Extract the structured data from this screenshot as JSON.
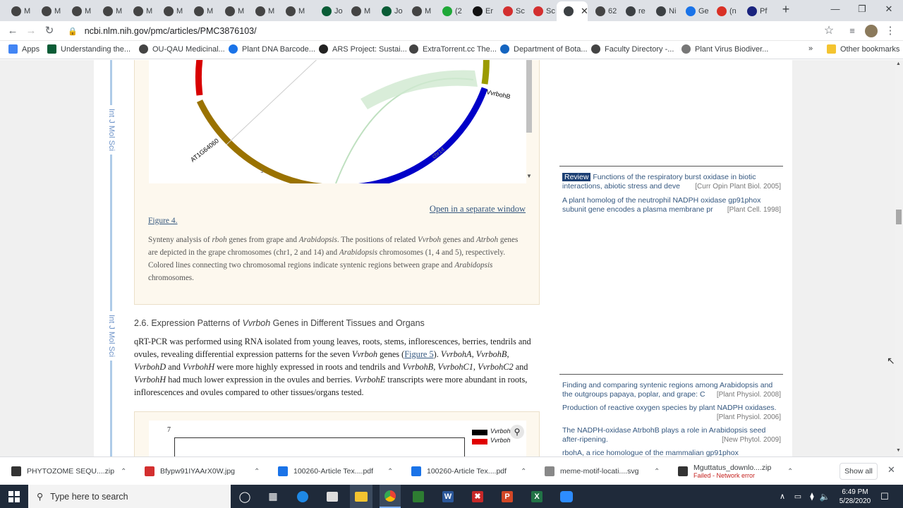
{
  "browser": {
    "tabs": [
      {
        "label": "M",
        "icon": "github-icon",
        "color": "#444"
      },
      {
        "label": "M",
        "icon": "github-icon",
        "color": "#444"
      },
      {
        "label": "M",
        "icon": "github-icon",
        "color": "#444"
      },
      {
        "label": "M",
        "icon": "github-icon",
        "color": "#444"
      },
      {
        "label": "M",
        "icon": "github-icon",
        "color": "#444"
      },
      {
        "label": "M",
        "icon": "github-icon",
        "color": "#444"
      },
      {
        "label": "M",
        "icon": "github-icon",
        "color": "#444"
      },
      {
        "label": "M",
        "icon": "github-icon",
        "color": "#444"
      },
      {
        "label": "M",
        "icon": "github-icon",
        "color": "#444"
      },
      {
        "label": "M",
        "icon": "github-icon",
        "color": "#444"
      },
      {
        "label": "Jo",
        "icon": "mendeley-icon",
        "color": "#0a5c36"
      },
      {
        "label": "M",
        "icon": "github-icon",
        "color": "#444"
      },
      {
        "label": "Jo",
        "icon": "mendeley-icon",
        "color": "#0a5c36"
      },
      {
        "label": "M",
        "icon": "github-icon",
        "color": "#444"
      },
      {
        "label": "(2",
        "icon": "green-circle-icon",
        "color": "#1fa838"
      },
      {
        "label": "Er",
        "icon": "d-icon",
        "color": "#111"
      },
      {
        "label": "Sc",
        "icon": "acrobat-icon",
        "color": "#d32f2f"
      },
      {
        "label": "Sc",
        "icon": "acrobat-icon",
        "color": "#d32f2f"
      },
      {
        "label": "",
        "icon": "ncbi-icon",
        "color": "#3c4043"
      },
      {
        "label": "62",
        "icon": "github-icon",
        "color": "#444"
      },
      {
        "label": "re",
        "icon": "ncbi-icon",
        "color": "#3c4043"
      },
      {
        "label": "Ni",
        "icon": "ncbi-icon",
        "color": "#3c4043"
      },
      {
        "label": "Ge",
        "icon": "diamond-icon",
        "color": "#1a73e8"
      },
      {
        "label": "(n",
        "icon": "gmail-icon",
        "color": "#d93025"
      },
      {
        "label": "Pf",
        "icon": "pfam-icon",
        "color": "#1a237e"
      }
    ],
    "url": "ncbi.nlm.nih.gov/pmc/articles/PMC3876103/",
    "bookmarks": [
      {
        "label": "Apps",
        "color": "#4285f4"
      },
      {
        "label": "Understanding the...",
        "color": "#0a5c36"
      },
      {
        "label": "OU-QAU Medicinal...",
        "color": "#444"
      },
      {
        "label": "Plant DNA Barcode...",
        "color": "#1a73e8"
      },
      {
        "label": "ARS Project: Sustai...",
        "color": "#222"
      },
      {
        "label": "ExtraTorrent.cc The...",
        "color": "#444"
      },
      {
        "label": "Department of Bota...",
        "color": "#1565c0"
      },
      {
        "label": "Faculty Directory -...",
        "color": "#444"
      },
      {
        "label": "Plant Virus Biodiver...",
        "color": "#777"
      }
    ],
    "bookmarks_more": "»",
    "other_bookmarks": "Other bookmarks"
  },
  "figure": {
    "labels": {
      "atig": "AT1G64060",
      "vvrbohb": "VvrbohB",
      "chr14": "chr14",
      "one": "1"
    },
    "open_window": "Open in a separate window",
    "figure_label": "Figure 4.",
    "caption": [
      {
        "t": "Synteny analysis of ",
        "i": false
      },
      {
        "t": "rboh",
        "i": true
      },
      {
        "t": " genes from grape and ",
        "i": false
      },
      {
        "t": "Arabidopsis",
        "i": true
      },
      {
        "t": ". The positions of related ",
        "i": false
      },
      {
        "t": "Vvrboh",
        "i": true
      },
      {
        "t": " genes and ",
        "i": false
      },
      {
        "t": "Atrboh",
        "i": true
      },
      {
        "t": " genes are depicted in the grape chromosomes (chr1, 2 and 14) and ",
        "i": false
      },
      {
        "t": "Arabidopsis",
        "i": true
      },
      {
        "t": " chromosomes (1, 4 and 5), respectively. Colored lines connecting two chromosomal regions indicate syntenic regions between grape and ",
        "i": false
      },
      {
        "t": "Arabidopsis",
        "i": true
      },
      {
        "t": " chromosomes.",
        "i": false
      }
    ]
  },
  "section": {
    "heading_parts": [
      {
        "t": "2.6. Expression Patterns of ",
        "i": false
      },
      {
        "t": "Vvrboh",
        "i": true
      },
      {
        "t": " Genes in Different Tissues and Organs",
        "i": false
      }
    ],
    "body": [
      {
        "t": "qRT-PCR was performed using RNA isolated from young leaves, roots, stems, inflorescences, berries, tendrils and ovules, revealing differential expression patterns for the seven ",
        "i": false
      },
      {
        "t": "Vvrboh",
        "i": true
      },
      {
        "t": " genes (",
        "i": false
      },
      {
        "t": "Figure 5",
        "i": false,
        "link": true
      },
      {
        "t": "). ",
        "i": false
      },
      {
        "t": "VvrbohA",
        "i": true
      },
      {
        "t": ", ",
        "i": false
      },
      {
        "t": "VvrbohB",
        "i": true
      },
      {
        "t": ", ",
        "i": false
      },
      {
        "t": "VvrbohD",
        "i": true
      },
      {
        "t": " and ",
        "i": false
      },
      {
        "t": "VvrbohH",
        "i": true
      },
      {
        "t": " were more highly expressed in roots and tendrils and ",
        "i": false
      },
      {
        "t": "VvrbohB",
        "i": true
      },
      {
        "t": ", ",
        "i": false
      },
      {
        "t": "VvrbohC1",
        "i": true
      },
      {
        "t": ", ",
        "i": false
      },
      {
        "t": "VvrbohC2",
        "i": true
      },
      {
        "t": " and ",
        "i": false
      },
      {
        "t": "VvrbohH",
        "i": true
      },
      {
        "t": " had much lower expression in the ovules and berries. ",
        "i": false
      },
      {
        "t": "VvrbohE",
        "i": true
      },
      {
        "t": " transcripts were more abundant in roots, inflorescences and ovules compared to other tissues/organs tested.",
        "i": false
      }
    ]
  },
  "figure5": {
    "tick": "7",
    "legend": [
      "Vvrboh",
      "Vvrboh"
    ]
  },
  "side_labels": [
    "Int J Mol Sci",
    "Int J Mol Sci"
  ],
  "sidebar": {
    "group1": [
      {
        "badge": "Review",
        "title": "Functions of the respiratory burst oxidase in biotic interactions, abiotic stress and deve",
        "cite": "[Curr Opin Plant Biol. 2005]"
      },
      {
        "badge": "",
        "title": "A plant homolog of the neutrophil NADPH oxidase gp91phox subunit gene encodes a plasma membrane pr",
        "cite": "[Plant Cell. 1998]"
      }
    ],
    "group2": [
      {
        "title": "Finding and comparing syntenic regions among Arabidopsis and the outgroups papaya, poplar, and grape: C",
        "cite": "[Plant Physiol. 2008]"
      },
      {
        "title": "Production of reactive oxygen species by plant NADPH oxidases.",
        "cite": "[Plant Physiol. 2006]"
      },
      {
        "title": "The NADPH-oxidase AtrbohB plays a role in Arabidopsis seed after-ripening.",
        "cite": "[New Phytol. 2009]"
      },
      {
        "title": "rbohA, a rice homologue of the mammalian gp91phox",
        "cite": ""
      }
    ]
  },
  "downloads": [
    {
      "name": "PHYTOZOME SEQU....zip",
      "color": "#333",
      "status": ""
    },
    {
      "name": "Bfypw91IYAArX0W.jpg",
      "color": "#d32f2f",
      "status": ""
    },
    {
      "name": "100260-Article Tex....pdf",
      "color": "#1a73e8",
      "status": ""
    },
    {
      "name": "100260-Article Tex....pdf",
      "color": "#1a73e8",
      "status": ""
    },
    {
      "name": "meme-motif-locati....svg",
      "color": "#888",
      "status": ""
    },
    {
      "name": "Mguttatus_downlo....zip",
      "color": "#333",
      "status": "Failed - Network error"
    }
  ],
  "downloads_show_all": "Show all",
  "taskbar": {
    "search_placeholder": "Type here to search",
    "time": "6:49 PM",
    "date": "5/28/2020"
  }
}
